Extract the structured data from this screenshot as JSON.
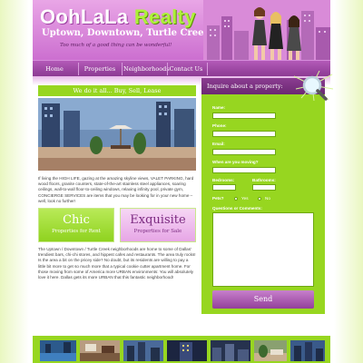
{
  "header": {
    "logo_part1": "OohLaLa",
    "logo_part2": " Realty",
    "tagline": "Uptown, Downtown, Turtle Creek",
    "subtagline": "Too much of a good thing can be wonderful!"
  },
  "nav": {
    "items": [
      "Home",
      "Properties",
      "Neighborhoods",
      "Contact Us"
    ]
  },
  "left": {
    "strip": "We do it all... Buy, Sell, Lease",
    "intro": "If living the HIGH LIFE, gazing at the amazing skyline views, VALET PARKING, hard wood floors, granite counters, state-of-the-art stainless steel appliances, soaring ceilings, wall-to-wall floor-to-ceiling windows, relaxing infinity pool, private gym, CONCIERGE SERVICES are items that you may be looking for in your new home – well, look no further!",
    "card_chic_title": "Chic",
    "card_chic_sub": "Properties for Rent",
    "card_exq_title": "Exquisite",
    "card_exq_sub": "Properties for Sale",
    "body": "The Uptown / Downtown / Turtle Creek neighborhoods are home to some of Dallas' trendiest bars, chi-chi stores, and hippest cafes and restaurants. The area truly rocks! Is the area a bit on the pricey side? No doubt, but its residents are willing to pay a little bit more to get so much more that a typical cookie cutter apartment home. For those moving from some of America more URBAN environments: You will absolutely love it here. Dallas gets its more URBAN that this fantastic neighborhood!"
  },
  "form": {
    "heading": "Inquire about a property:",
    "labels": {
      "name": "Name:",
      "phone": "Phone:",
      "email": "Email:",
      "moving": "When are you moving?",
      "bedrooms": "Bedrooms:",
      "bathrooms": "Bathrooms:",
      "pets": "Pets?",
      "yes": "Yes",
      "no": "No",
      "questions": "Questions or Comments:"
    },
    "send_label": "Send"
  },
  "colors": {
    "accent_green": "#97d620",
    "accent_purple": "#8b3d91",
    "header_pink": "#e9a6e6"
  }
}
